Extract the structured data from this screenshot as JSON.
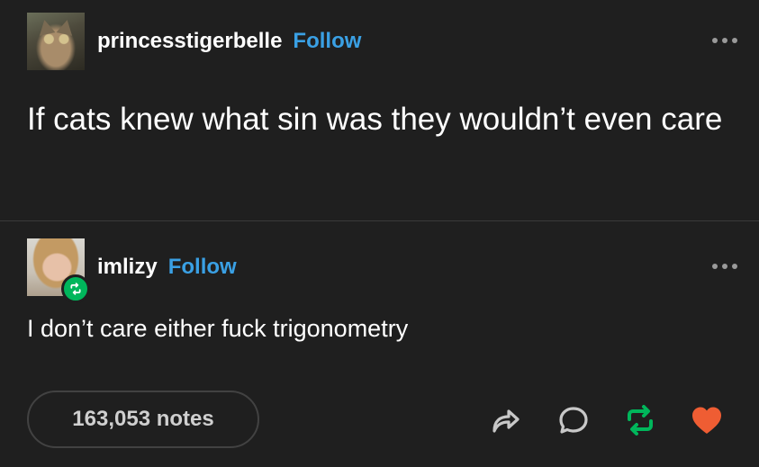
{
  "post": {
    "author": {
      "username": "princesstigerbelle",
      "follow_label": "Follow",
      "avatar_icon": "cat-avatar",
      "text": "If cats knew what sin was they wouldn’t even care"
    },
    "reblog": {
      "username": "imlizy",
      "follow_label": "Follow",
      "avatar_icon": "person-avatar",
      "badge_icon": "reblog-badge-icon",
      "text": "I don’t care either fuck trigonometry"
    },
    "footer": {
      "notes_label": "163,053 notes",
      "actions": [
        {
          "name": "share",
          "icon": "share-icon"
        },
        {
          "name": "reply",
          "icon": "reply-icon"
        },
        {
          "name": "reblog",
          "icon": "reblog-icon"
        },
        {
          "name": "like",
          "icon": "heart-icon"
        }
      ]
    },
    "colors": {
      "background": "#1f1f1f",
      "follow_link": "#3aa0e4",
      "reblog_green": "#00b65b",
      "like_red": "#ef5d33",
      "divider": "#3a3a3a"
    }
  }
}
